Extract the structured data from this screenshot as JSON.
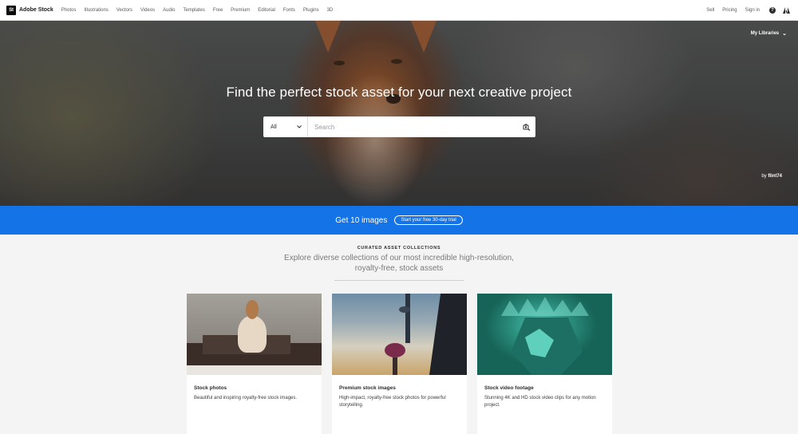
{
  "brand": {
    "logo_text": "St",
    "name": "Adobe Stock"
  },
  "nav": {
    "items": [
      "Photos",
      "Illustrations",
      "Vectors",
      "Videos",
      "Audio",
      "Templates",
      "Free",
      "Premium",
      "Editorial",
      "Fonts",
      "Plugins",
      "3D"
    ],
    "right": {
      "sell": "Sell",
      "pricing": "Pricing",
      "signin": "Sign in",
      "help_glyph": "?"
    }
  },
  "hero": {
    "my_libraries": "My Libraries",
    "title": "Find the perfect stock asset for your next creative project",
    "search": {
      "filter_value": "All",
      "placeholder": "Search"
    },
    "credit_prefix": "by",
    "credit_author": "flint74"
  },
  "promo": {
    "text": "Get 10 images",
    "button": "Start your free 30-day trial",
    "color": "#1473e6"
  },
  "collections": {
    "eyebrow": "CURATED ASSET COLLECTIONS",
    "subtitle": "Explore diverse collections of our most incredible high-resolution, royalty-free, stock assets",
    "cards": [
      {
        "title": "Stock photos",
        "description": "Beautiful and inspiring royalty-free stock images."
      },
      {
        "title": "Premium stock images",
        "description": "High-impact, royalty-free stock photos for powerful storytelling."
      },
      {
        "title": "Stock video footage",
        "description": "Stunning 4K and HD stock video clips for any motion project."
      }
    ]
  },
  "icons": {
    "search_filter": "chevron-down-icon",
    "visual_search": "camera-search-icon",
    "libraries": "chevron-down-icon",
    "help": "help-icon",
    "adobe": "adobe-logo-icon"
  }
}
